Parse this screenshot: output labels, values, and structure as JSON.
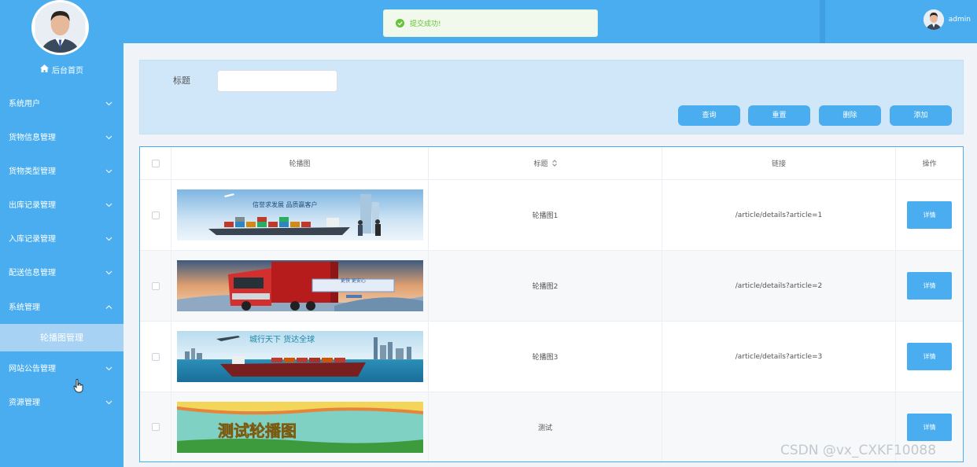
{
  "sidebar": {
    "home_label": "后台首页",
    "menu": [
      {
        "label": "系统用户"
      },
      {
        "label": "货物信息管理"
      },
      {
        "label": "货物类型管理"
      },
      {
        "label": "出库记录管理"
      },
      {
        "label": "入库记录管理"
      },
      {
        "label": "配送信息管理"
      },
      {
        "label": "系统管理",
        "expanded": true
      },
      {
        "label": "网站公告管理"
      },
      {
        "label": "资源管理"
      }
    ],
    "active_sub": "轮播图管理"
  },
  "header": {
    "toast": "提交成功!",
    "username": "admin"
  },
  "search": {
    "title_label": "标题",
    "title_value": "",
    "buttons": {
      "query": "查询",
      "reset": "重置",
      "delete": "删除",
      "add": "添加"
    }
  },
  "table": {
    "columns": {
      "image": "轮播图",
      "title": "标题",
      "link": "链接",
      "actions": "操作"
    },
    "rows": [
      {
        "title": "轮播图1",
        "link": "/article/details?article=1",
        "action": "详情",
        "banner_text": "信誉求发展 品质赢客户"
      },
      {
        "title": "轮播图2",
        "link": "/article/details?article=2",
        "action": "详情",
        "banner_text": "更快 更安心"
      },
      {
        "title": "轮播图3",
        "link": "/article/details?article=3",
        "action": "详情",
        "banner_text": "城行天下 货达全球"
      },
      {
        "title": "测试",
        "link": "",
        "action": "详情",
        "banner_text": "测试轮播图"
      }
    ]
  },
  "watermark": "CSDN @vx_CXKF10088",
  "colors": {
    "primary": "#49adf0",
    "sidebar_active": "#a8d2f4",
    "success": "#67c23a",
    "search_bg": "#d0e6f9"
  }
}
